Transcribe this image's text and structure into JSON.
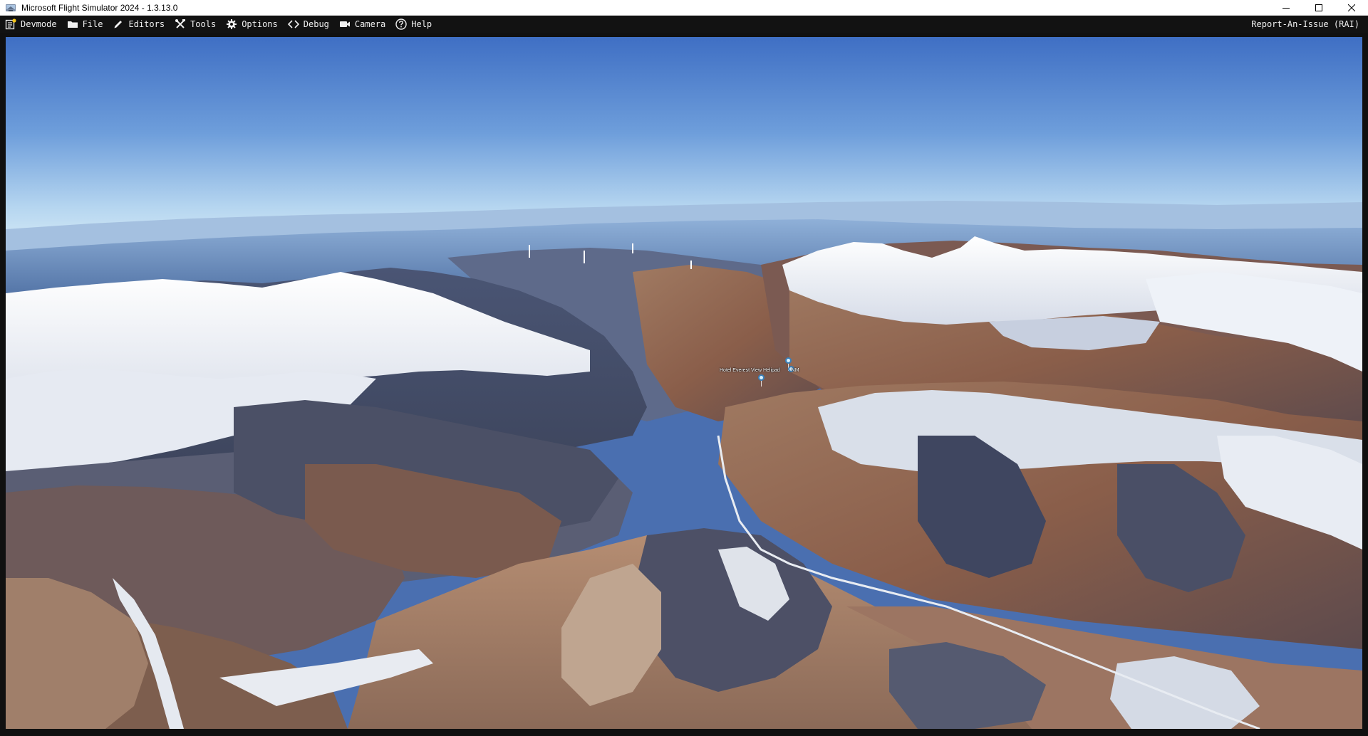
{
  "window": {
    "title": "Microsoft Flight Simulator 2024 - 1.3.13.0",
    "icon": "flight-simulator-app-icon"
  },
  "menubar": {
    "items": [
      {
        "label": "Devmode",
        "icon": "devmode-icon"
      },
      {
        "label": "File",
        "icon": "folder-icon"
      },
      {
        "label": "Editors",
        "icon": "pencil-icon"
      },
      {
        "label": "Tools",
        "icon": "tools-icon"
      },
      {
        "label": "Options",
        "icon": "gear-icon"
      },
      {
        "label": "Debug",
        "icon": "code-brackets-icon"
      },
      {
        "label": "Camera",
        "icon": "video-camera-icon"
      },
      {
        "label": "Help",
        "icon": "question-circle-icon"
      }
    ],
    "report_issue": "Report-An-Issue (RAI)"
  },
  "viewport": {
    "scene": "aerial-view-snowy-mountain-valley",
    "poi": {
      "label": "Hotel Everest View Helipad",
      "distance": "NM"
    }
  },
  "colors": {
    "sky_top": "#3f6fc4",
    "sky_horizon": "#cfe6f5",
    "menubar_bg": "#121212",
    "titlebar_bg": "#ffffff"
  }
}
